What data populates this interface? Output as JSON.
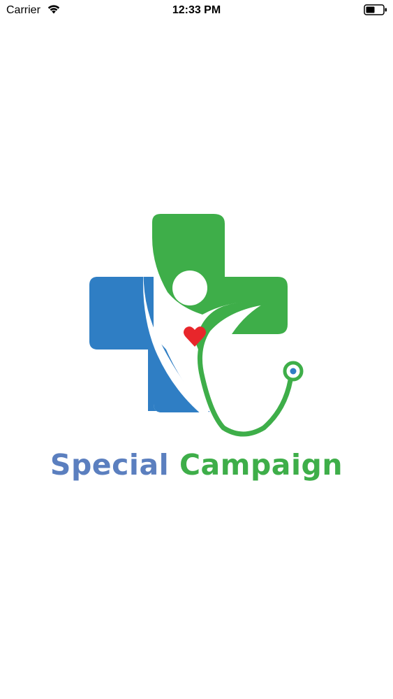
{
  "status_bar": {
    "carrier": "Carrier",
    "time": "12:33 PM",
    "icons": [
      "wifi-icon",
      "battery-icon"
    ]
  },
  "splash": {
    "logo_icon": "medical-cross-stethoscope-logo",
    "brand_word_1": "Special",
    "brand_word_2": "Campaign"
  },
  "colors": {
    "blue": "#2f7ec4",
    "green": "#3eae49",
    "heart": "#e8262b",
    "brand_blue_text": "#5b7fbf"
  }
}
